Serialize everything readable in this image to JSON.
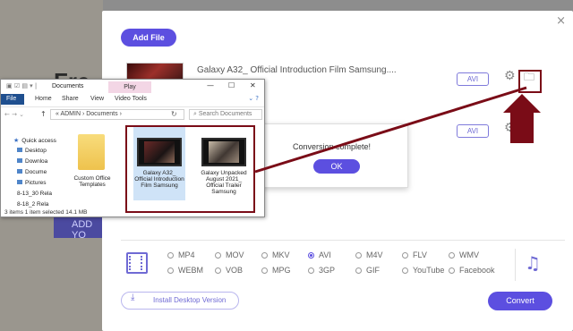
{
  "background": {
    "heading_fragment": "Fre",
    "add_button_fragment": "ADD YO"
  },
  "dialog": {
    "close_icon": "×",
    "add_file_label": "Add File",
    "files": [
      {
        "name": "Galaxy A32_ Official Introduction Film Samsung....",
        "format": "AVI"
      },
      {
        "name": "",
        "format": "AVI"
      }
    ],
    "formats": {
      "row1": [
        "MP4",
        "MOV",
        "MKV",
        "AVI",
        "M4V",
        "FLV",
        "WMV"
      ],
      "row2": [
        "WEBM",
        "VOB",
        "MPG",
        "3GP",
        "GIF",
        "YouTube",
        "Facebook"
      ],
      "selected": "AVI"
    },
    "install_label": "Install Desktop Version",
    "convert_label": "Convert"
  },
  "popup": {
    "message": "Conversion complete!",
    "ok_label": "OK"
  },
  "explorer": {
    "title": "Documents",
    "play_tab": "Play",
    "ribbon_tabs": [
      "File",
      "Home",
      "Share",
      "View",
      "Video Tools"
    ],
    "breadcrumb": "« ADMIN › Documents ›",
    "search_placeholder": "Search Documents",
    "nav_items": [
      "Quick access",
      "Desktop",
      "Downloa",
      "Docume",
      "Pictures",
      "8-13_30 Rela",
      "8-18_2 Rela"
    ],
    "folder_label": "Custom Office Templates",
    "files": [
      {
        "label": "Galaxy A32_ Official Introduction Film Samsung",
        "selected": true
      },
      {
        "label": "Galaxy Unpacked August 2021_ Official Trailer Samsung",
        "selected": false
      }
    ],
    "status": "3 items    1 item selected  14.1 MB"
  },
  "colors": {
    "accent": "#5c4fe0",
    "annotation": "#7a0c17"
  }
}
